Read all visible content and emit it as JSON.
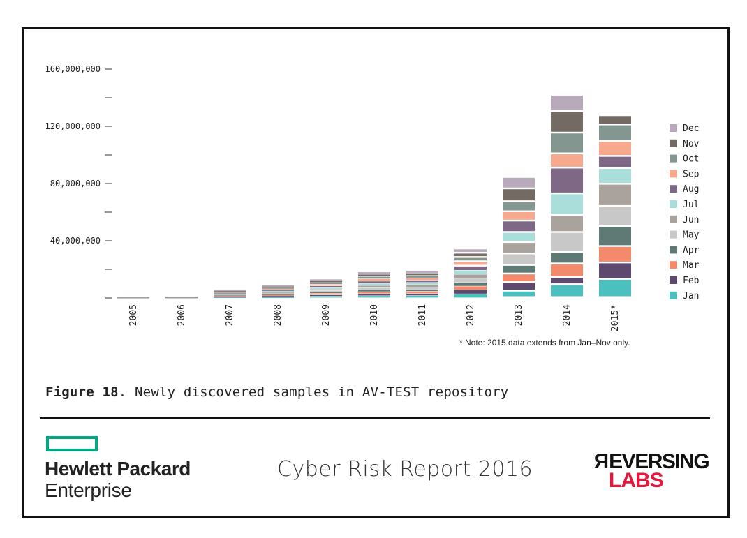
{
  "chart_data": {
    "type": "bar",
    "stacked": true,
    "title": "Newly discovered samples in AV-TEST repository",
    "xlabel": "",
    "ylabel": "",
    "ylim": [
      0,
      160000000
    ],
    "yticks_major": [
      {
        "value": 40000000,
        "label": "40,000,000"
      },
      {
        "value": 80000000,
        "label": "80,000,000"
      },
      {
        "value": 120000000,
        "label": "120,000,000"
      },
      {
        "value": 160000000,
        "label": "160,000,000"
      }
    ],
    "yticks_minor": [
      0,
      20000000,
      60000000,
      100000000,
      140000000
    ],
    "grid": false,
    "legend_position": "right",
    "categories": [
      "2005",
      "2006",
      "2007",
      "2008",
      "2009",
      "2010",
      "2011",
      "2012",
      "2013",
      "2014",
      "2015*"
    ],
    "series": [
      {
        "name": "Jan",
        "color": "#4cc0bf",
        "values": [
          40000,
          80000,
          450000,
          700000,
          1000000,
          1400000,
          1500000,
          2700000,
          4500000,
          9000000,
          12700000
        ]
      },
      {
        "name": "Feb",
        "color": "#5e4a6e",
        "values": [
          40000,
          80000,
          450000,
          700000,
          1000000,
          1400000,
          1500000,
          2700000,
          6000000,
          5000000,
          11500000
        ]
      },
      {
        "name": "Mar",
        "color": "#f48a6c",
        "values": [
          40000,
          80000,
          450000,
          700000,
          1000000,
          1400000,
          1500000,
          2700000,
          6000000,
          9500000,
          11500000
        ]
      },
      {
        "name": "Apr",
        "color": "#5f7a74",
        "values": [
          40000,
          80000,
          450000,
          700000,
          1000000,
          1400000,
          1500000,
          2700000,
          6000000,
          8000000,
          14000000
        ]
      },
      {
        "name": "May",
        "color": "#c8c8c8",
        "values": [
          40000,
          80000,
          450000,
          700000,
          1000000,
          1500000,
          1500000,
          2800000,
          8000000,
          14000000,
          14000000
        ]
      },
      {
        "name": "Jun",
        "color": "#aaa29c",
        "values": [
          40000,
          80000,
          450000,
          700000,
          1100000,
          1500000,
          1600000,
          2800000,
          8000000,
          12000000,
          15500000
        ]
      },
      {
        "name": "Jul",
        "color": "#a9dedb",
        "values": [
          40000,
          80000,
          450000,
          750000,
          1100000,
          1500000,
          1600000,
          2800000,
          7000000,
          15000000,
          11000000
        ]
      },
      {
        "name": "Aug",
        "color": "#7e6885",
        "values": [
          40000,
          80000,
          450000,
          750000,
          1100000,
          1500000,
          1600000,
          2800000,
          8000000,
          18000000,
          8500000
        ]
      },
      {
        "name": "Sep",
        "color": "#f7a98e",
        "values": [
          40000,
          80000,
          450000,
          750000,
          1100000,
          1600000,
          1600000,
          3000000,
          6500000,
          10000000,
          10500000
        ]
      },
      {
        "name": "Oct",
        "color": "#849690",
        "values": [
          40000,
          80000,
          450000,
          750000,
          1200000,
          1600000,
          1700000,
          3000000,
          7000000,
          14500000,
          11500000
        ]
      },
      {
        "name": "Nov",
        "color": "#736a64",
        "values": [
          40000,
          80000,
          500000,
          800000,
          1200000,
          1600000,
          1700000,
          3000000,
          9000000,
          15000000,
          6500000
        ]
      },
      {
        "name": "Dec",
        "color": "#b8aabb",
        "values": [
          60000,
          120000,
          500000,
          800000,
          1200000,
          1600000,
          1700000,
          3000000,
          8000000,
          11500000,
          0
        ]
      }
    ],
    "annotation": "* Note: 2015 data extends from Jan–Nov only."
  },
  "caption": {
    "figure_label": "Figure 18",
    "text": ". Newly discovered samples in AV-TEST repository"
  },
  "footer": {
    "hpe_line1": "Hewlett Packard",
    "hpe_line2": "Enterprise",
    "report_title": "Cyber Risk Report 2016",
    "rl_line1": "REVERSING",
    "rl_line2": "LABS",
    "hpe_color": "#01a982",
    "rl_accent": "#e3183b"
  }
}
